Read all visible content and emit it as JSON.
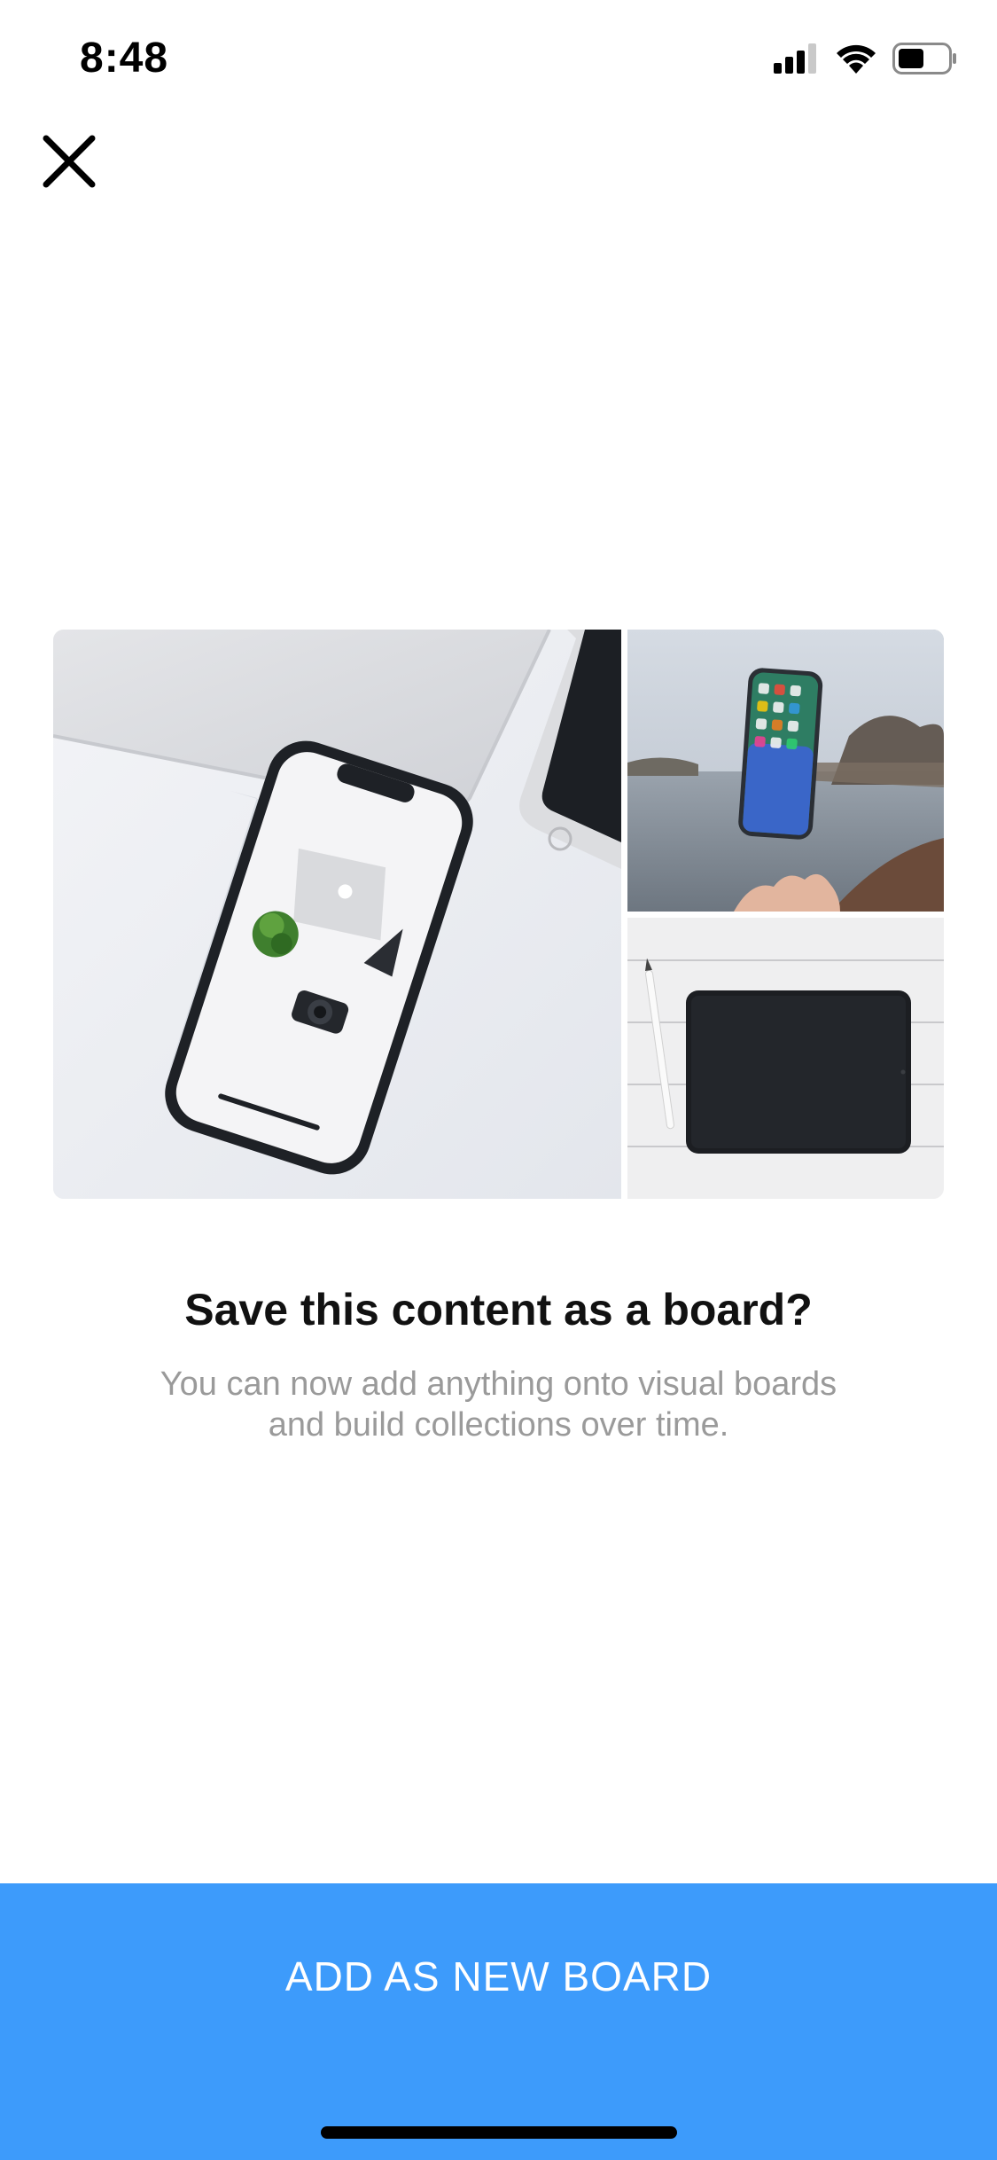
{
  "status_bar": {
    "time": "8:48",
    "icons": [
      "cellular-signal-icon",
      "wifi-icon",
      "battery-icon"
    ]
  },
  "header": {
    "close_icon": "close-icon"
  },
  "collage": {
    "images": [
      "phone-on-desk-photo",
      "floating-phone-lake-photo",
      "tablet-with-pencil-photo"
    ]
  },
  "dialog": {
    "title": "Save this content as a board?",
    "subtitle_line1": "You can now add anything onto visual boards",
    "subtitle_line2": "and build collections over time."
  },
  "cta": {
    "label": "ADD AS NEW BOARD"
  },
  "colors": {
    "accent": "#3d9bfb",
    "title": "#111111",
    "subtitle": "#9a9a9a"
  }
}
